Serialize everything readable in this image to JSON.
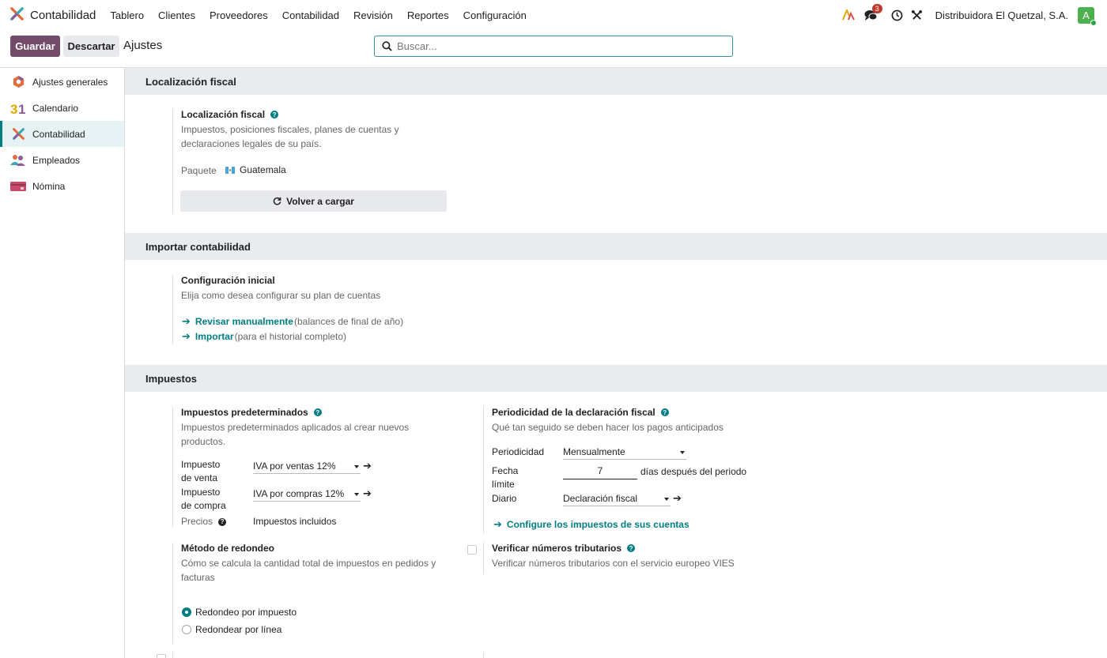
{
  "navbar": {
    "app_name": "Contabilidad",
    "menu": [
      "Tablero",
      "Clientes",
      "Proveedores",
      "Contabilidad",
      "Revisión",
      "Reportes",
      "Configuración"
    ],
    "chat_badge": "3",
    "company": "Distribuidora El Quetzal, S.A.",
    "avatar_letter": "A"
  },
  "control": {
    "save_label": "Guardar",
    "discard_label": "Descartar",
    "title": "Ajustes",
    "search_placeholder": "Buscar..."
  },
  "sidebar": {
    "items": [
      {
        "label": "Ajustes generales",
        "icon": "settings-icon"
      },
      {
        "label": "Calendario",
        "icon": "calendar-icon"
      },
      {
        "label": "Contabilidad",
        "icon": "accounting-icon"
      },
      {
        "label": "Empleados",
        "icon": "employees-icon"
      },
      {
        "label": "Nómina",
        "icon": "payroll-icon"
      }
    ],
    "active": "Contabilidad"
  },
  "sections": {
    "fiscal": {
      "header": "Localización fiscal",
      "title": "Localización fiscal",
      "desc_line1": "Impuestos, posiciones fiscales, planes de cuentas y",
      "desc_line2": "declaraciones legales de su país.",
      "package_label": "Paquete",
      "package_value": "Guatemala",
      "reload_label": "Volver a cargar"
    },
    "import": {
      "header": "Importar contabilidad",
      "title": "Configuración inicial",
      "desc": "Elija como desea configurar su plan de cuentas",
      "link1": "Revisar manualmente",
      "link1_note": "(balances de final de año)",
      "link2": "Importar",
      "link2_note": "(para el historial completo)"
    },
    "taxes": {
      "header": "Impuestos",
      "default_title": "Impuestos predeterminados",
      "default_desc_line1": "Impuestos predeterminados aplicados al crear nuevos",
      "default_desc_line2": "productos.",
      "sale_label_1": "Impuesto",
      "sale_label_2": "de venta",
      "sale_value": "IVA por ventas 12%",
      "purchase_label_1": "Impuesto",
      "purchase_label_2": "de compra",
      "purchase_value": "IVA por compras 12%",
      "prices_label": "Precios",
      "prices_value": "Impuestos incluidos",
      "periodicity_title": "Periodicidad de la declaración fiscal",
      "periodicity_desc": "Qué tan seguido se deben hacer los pagos anticipados",
      "periodicity_label": "Periodicidad",
      "periodicity_value": "Mensualmente",
      "deadline_label_1": "Fecha",
      "deadline_label_2": "límite",
      "deadline_value": "7",
      "deadline_suffix": "días después del periodo",
      "journal_label": "Diario",
      "journal_value": "Declaración fiscal",
      "configure_link": "Configure los impuestos de sus cuentas",
      "rounding_title": "Método de redondeo",
      "rounding_desc_line1": "Cómo se calcula la cantidad total de impuestos en pedidos y",
      "rounding_desc_line2": "facturas",
      "rounding_opt1": "Redondeo por impuesto",
      "rounding_opt2": "Redondear por línea",
      "vat_title": "Verificar números tributarios",
      "vat_desc": "Verificar números tributarios con el servicio europeo VIES"
    }
  }
}
